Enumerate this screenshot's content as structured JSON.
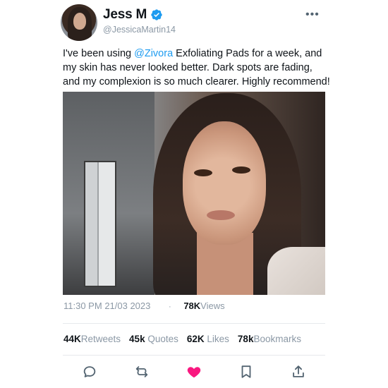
{
  "user": {
    "display_name": "Jess M",
    "handle": "@JessicaMartin14",
    "verified": true
  },
  "tweet": {
    "text_before": "I've been using ",
    "mention": "@Zivora",
    "text_after": " Exfoliating Pads for a week, and my skin has never looked better. Dark spots are fading, and my complexion is so much clearer. Highly recommend!",
    "time": "11:30 PM",
    "date": "21/03 2023",
    "separator": "·",
    "views_count": "78K",
    "views_label": "Views",
    "media_alt": "photo"
  },
  "stats": {
    "retweets_count": "44K",
    "retweets_label": "Retweets",
    "quotes_count": "45k",
    "quotes_label": "Quotes",
    "likes_count": "62K",
    "likes_label": "Likes",
    "bookmarks_count": "78k",
    "bookmarks_label": "Bookmarks"
  },
  "actions": {
    "reply_icon": "reply-icon",
    "retweet_icon": "retweet-icon",
    "like_icon": "heart-icon",
    "bookmark_icon": "bookmark-icon",
    "share_icon": "share-icon",
    "more_icon": "more-icon"
  },
  "colors": {
    "accent": "#1d9bf0",
    "like_active": "#f91880",
    "muted_text": "#8b98a5"
  }
}
